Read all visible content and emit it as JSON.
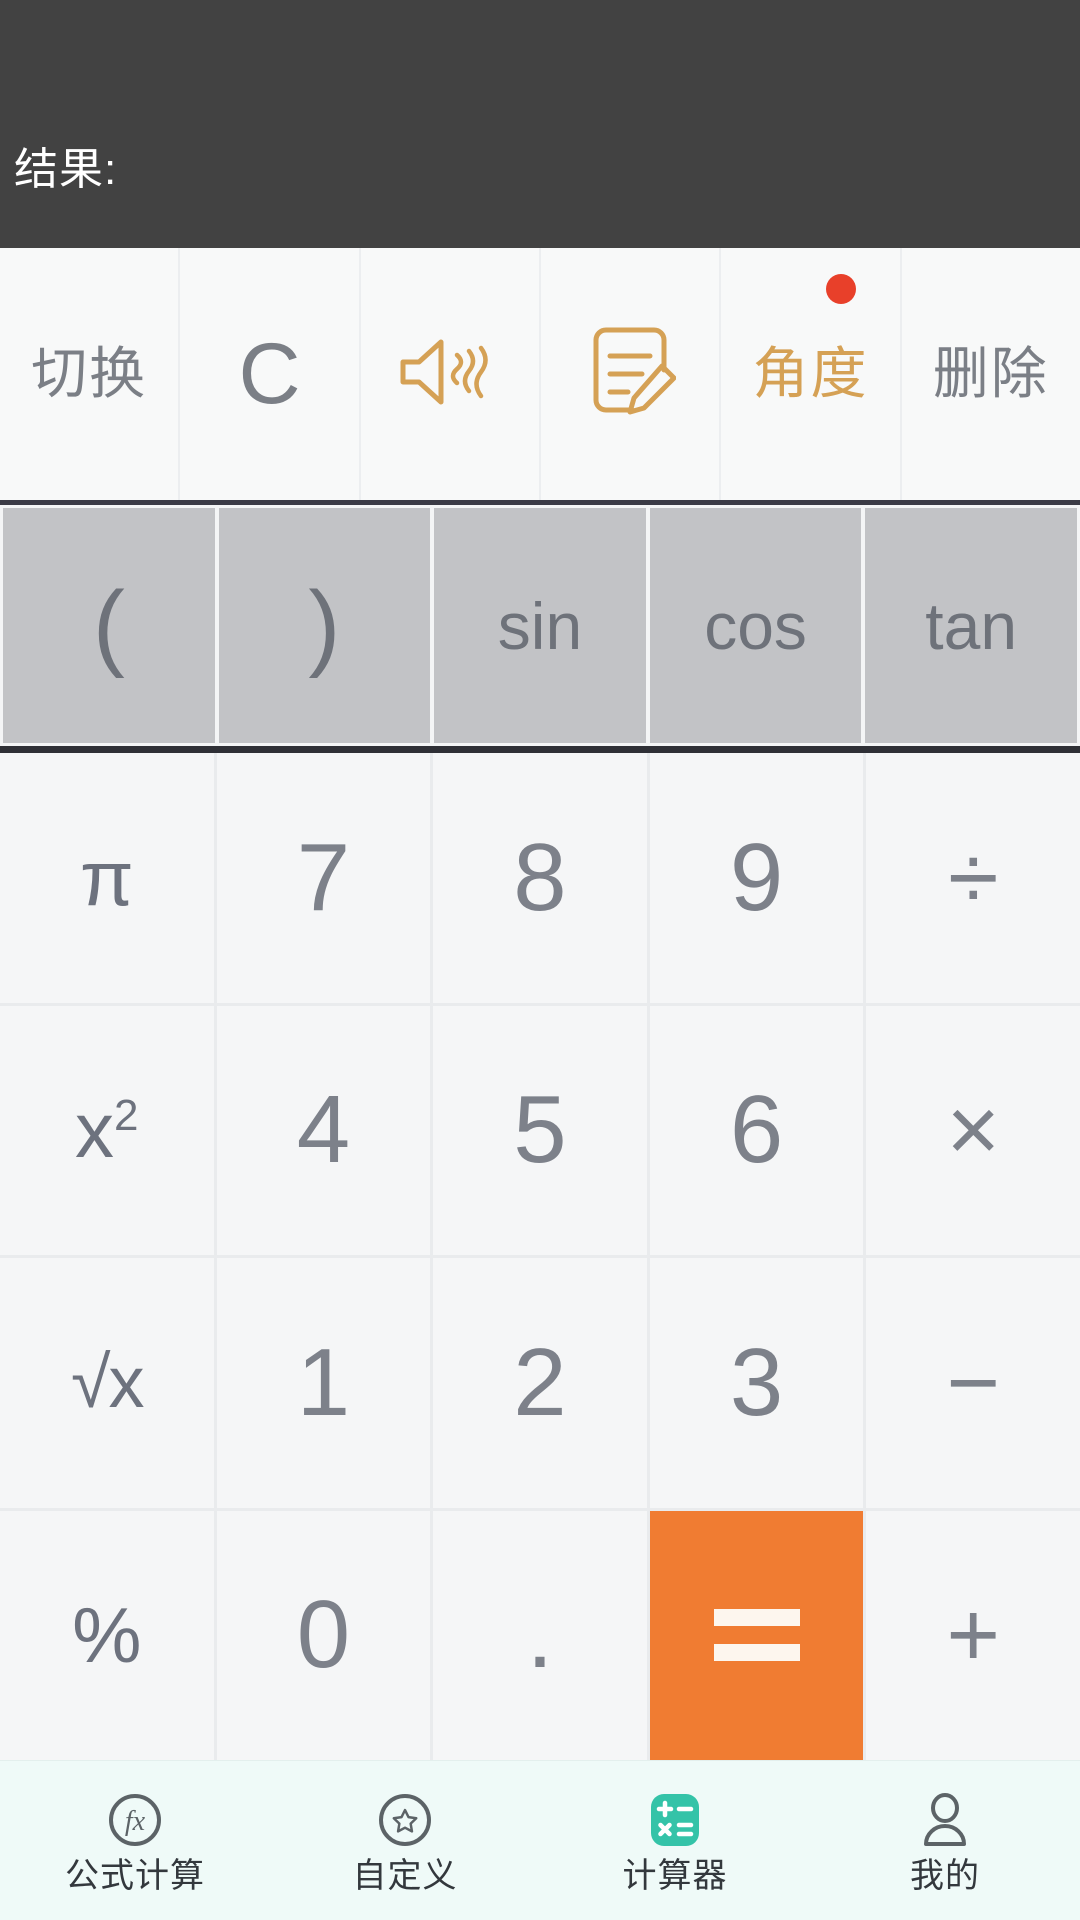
{
  "display": {
    "result_label": "结果:",
    "background_color": "#424242",
    "text_color": "#ffffff"
  },
  "toolbar": {
    "items": [
      {
        "id": "switch",
        "label": "切换",
        "type": "text",
        "style": "gray",
        "badge": false
      },
      {
        "id": "clear",
        "label": "C",
        "type": "text",
        "style": "gray",
        "badge": false
      },
      {
        "id": "sound",
        "label": "",
        "type": "icon",
        "icon": "speaker-vibrate-icon",
        "style": "gold",
        "badge": false
      },
      {
        "id": "note",
        "label": "",
        "type": "icon",
        "icon": "note-edit-icon",
        "style": "gold",
        "badge": false
      },
      {
        "id": "angle",
        "label": "角度",
        "type": "text",
        "style": "gold",
        "badge": true
      },
      {
        "id": "delete",
        "label": "删除",
        "type": "text",
        "style": "gray",
        "badge": false
      }
    ],
    "badge_color": "#e8402a",
    "gold_color": "#d5a155",
    "gray_color": "#7b7f86"
  },
  "function_row": {
    "background_color": "#c2c3c6",
    "keys": [
      {
        "id": "open-paren",
        "label": "("
      },
      {
        "id": "close-paren",
        "label": ")"
      },
      {
        "id": "sin",
        "label": "sin"
      },
      {
        "id": "cos",
        "label": "cos"
      },
      {
        "id": "tan",
        "label": "tan"
      }
    ]
  },
  "keypad": {
    "accent_color": "#f07c32",
    "rows": [
      [
        {
          "id": "pi",
          "label": "π",
          "kind": "sci"
        },
        {
          "id": "digit-7",
          "label": "7",
          "kind": "digit"
        },
        {
          "id": "digit-8",
          "label": "8",
          "kind": "digit"
        },
        {
          "id": "digit-9",
          "label": "9",
          "kind": "digit"
        },
        {
          "id": "divide",
          "label": "÷",
          "kind": "op"
        }
      ],
      [
        {
          "id": "square",
          "label": "x²",
          "kind": "sci"
        },
        {
          "id": "digit-4",
          "label": "4",
          "kind": "digit"
        },
        {
          "id": "digit-5",
          "label": "5",
          "kind": "digit"
        },
        {
          "id": "digit-6",
          "label": "6",
          "kind": "digit"
        },
        {
          "id": "multiply",
          "label": "×",
          "kind": "op"
        }
      ],
      [
        {
          "id": "sqrt",
          "label": "√x",
          "kind": "sci"
        },
        {
          "id": "digit-1",
          "label": "1",
          "kind": "digit"
        },
        {
          "id": "digit-2",
          "label": "2",
          "kind": "digit"
        },
        {
          "id": "digit-3",
          "label": "3",
          "kind": "digit"
        },
        {
          "id": "minus",
          "label": "−",
          "kind": "op"
        }
      ],
      [
        {
          "id": "percent",
          "label": "%",
          "kind": "sci"
        },
        {
          "id": "digit-0",
          "label": "0",
          "kind": "digit"
        },
        {
          "id": "decimal",
          "label": ".",
          "kind": "digit"
        },
        {
          "id": "equals",
          "label": "=",
          "kind": "equals"
        },
        {
          "id": "plus",
          "label": "+",
          "kind": "op"
        }
      ]
    ]
  },
  "bottom_nav": {
    "background_color": "#effaf8",
    "active_color": "#34c3a8",
    "items": [
      {
        "id": "formula",
        "label": "公式计算",
        "icon": "fx-circle-icon",
        "active": false
      },
      {
        "id": "custom",
        "label": "自定义",
        "icon": "star-circle-icon",
        "active": false
      },
      {
        "id": "calculator",
        "label": "计算器",
        "icon": "calculator-icon",
        "active": true
      },
      {
        "id": "mine",
        "label": "我的",
        "icon": "person-icon",
        "active": false
      }
    ]
  }
}
